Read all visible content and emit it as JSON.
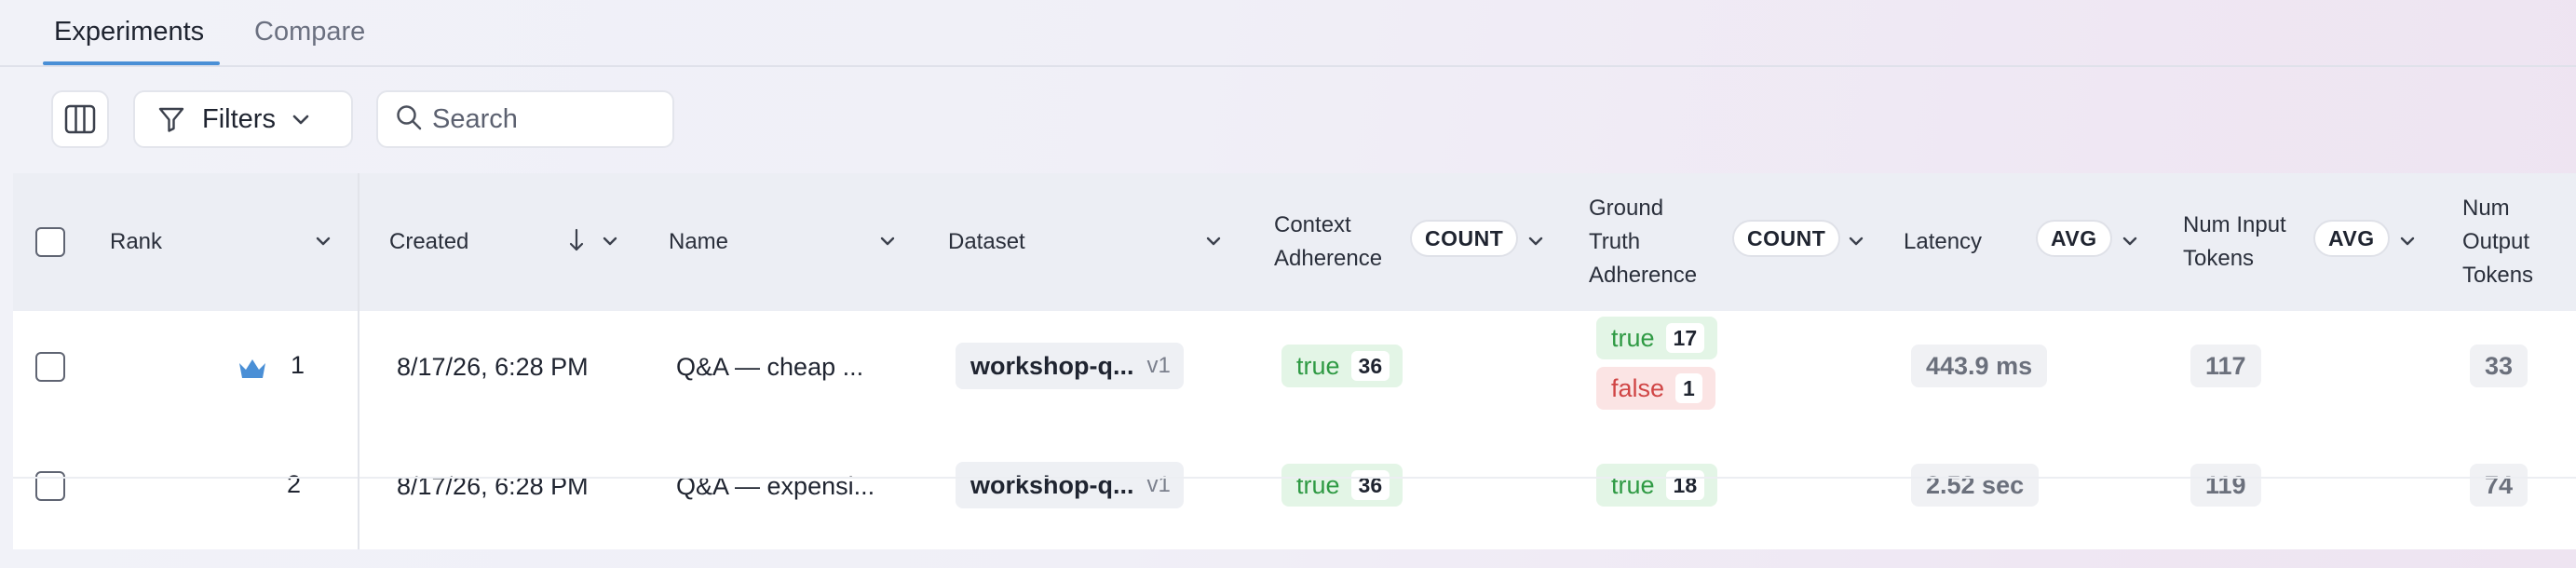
{
  "tabs": [
    {
      "label": "Experiments",
      "active": true
    },
    {
      "label": "Compare",
      "active": false
    }
  ],
  "toolbar": {
    "columns_icon": "columns-icon",
    "filters_label": "Filters",
    "search_placeholder": "Search"
  },
  "columns": {
    "rank": "Rank",
    "created": "Created",
    "name": "Name",
    "dataset": "Dataset",
    "context_adherence": [
      "Context",
      "Adherence"
    ],
    "ground_truth_adherence": [
      "Ground",
      "Truth",
      "Adherence"
    ],
    "latency": "Latency",
    "num_input_tokens": [
      "Num Input",
      "Tokens"
    ],
    "num_output_tokens": [
      "Num",
      "Output",
      "Tokens"
    ],
    "agg_count": "COUNT",
    "agg_avg": "AVG"
  },
  "rows": [
    {
      "rank": "1",
      "crown": true,
      "created": "8/17/26, 6:28 PM",
      "name": "Q&A — cheap ...",
      "dataset": "workshop-q...",
      "dataset_version": "v1",
      "context_adherence": [
        {
          "label": "true",
          "count": "36"
        }
      ],
      "ground_truth_adherence": [
        {
          "label": "true",
          "count": "17"
        },
        {
          "label": "false",
          "count": "1"
        }
      ],
      "latency": "443.9 ms",
      "num_input_tokens": "117",
      "num_output_tokens": "33"
    },
    {
      "rank": "2",
      "crown": false,
      "created": "8/17/26, 6:28 PM",
      "name": "Q&A — expensi...",
      "dataset": "workshop-q...",
      "dataset_version": "v1",
      "context_adherence": [
        {
          "label": "true",
          "count": "36"
        }
      ],
      "ground_truth_adherence": [
        {
          "label": "true",
          "count": "18"
        }
      ],
      "latency": "2.52 sec",
      "num_input_tokens": "119",
      "num_output_tokens": "74"
    }
  ],
  "colors": {
    "accent": "#4a8fd6",
    "true_bg": "#e3f5e6",
    "true_text": "#2f9a44",
    "false_bg": "#fbe4e4",
    "false_text": "#d04545"
  }
}
